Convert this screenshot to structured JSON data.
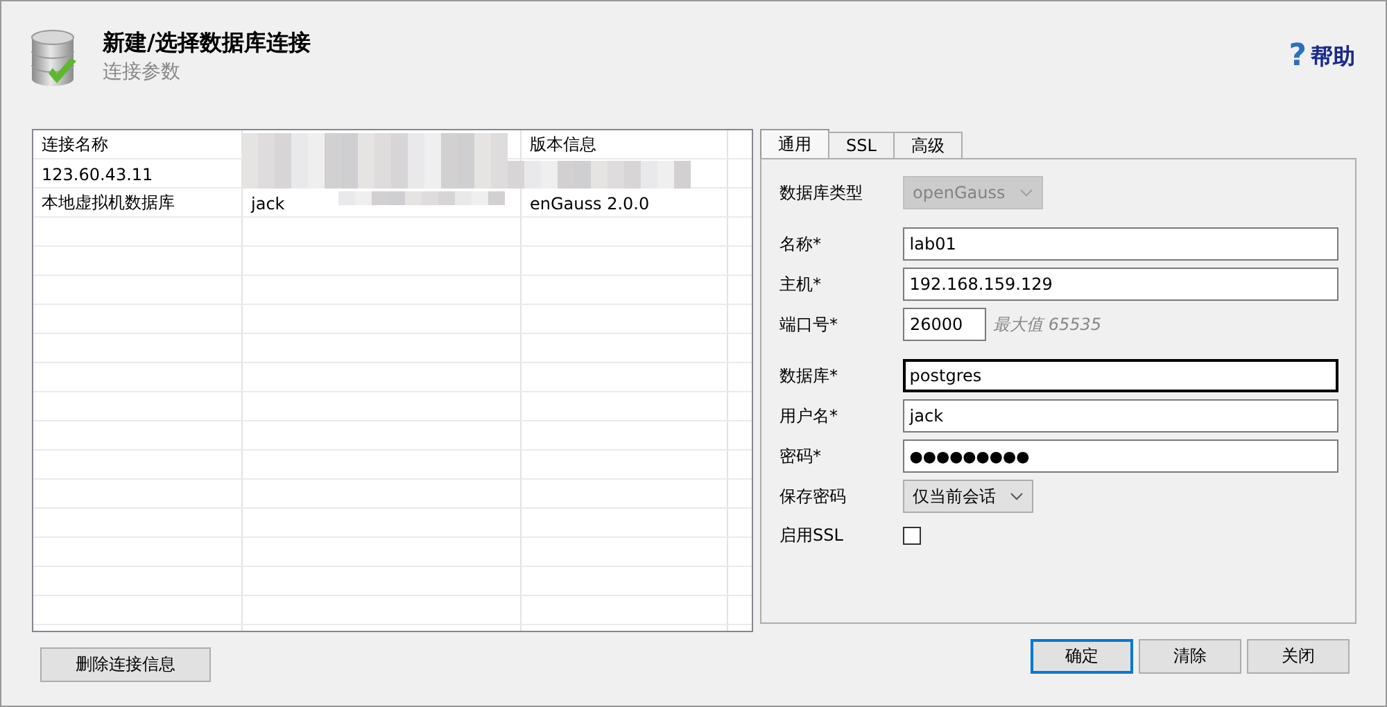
{
  "header": {
    "title": "新建/选择数据库连接",
    "subtitle": "连接参数",
    "help_icon": "?",
    "help_label": "帮助"
  },
  "table": {
    "columns": {
      "column_1": "连接名称",
      "column_3": "版本信息"
    },
    "rows": [
      {
        "column_1": "123.60.43.11"
      },
      {
        "column_1": "本地虚拟机数据库",
        "column_2": "jack",
        "column_3": "enGauss 2.0.0"
      }
    ]
  },
  "tabs": [
    {
      "label": "通用",
      "selected": true
    },
    {
      "label": "SSL",
      "selected": false
    },
    {
      "label": "高级",
      "selected": false
    }
  ],
  "form": [
    {
      "kind": "select",
      "label": "数据库类型",
      "value": "openGauss",
      "disabled": true
    },
    {
      "kind": "text",
      "label": "名称*",
      "value": "lab01",
      "focused": false
    },
    {
      "kind": "text",
      "label": "主机*",
      "value": "192.168.159.129",
      "focused": false
    },
    {
      "kind": "port",
      "label": "端口号*",
      "value": "26000",
      "hint": "最大值 65535",
      "focused": false
    },
    {
      "kind": "text",
      "label": "数据库*",
      "value": "postgres",
      "focused": true
    },
    {
      "kind": "text",
      "label": "用户名*",
      "value": "jack",
      "focused": false
    },
    {
      "kind": "password",
      "label": "密码*",
      "value": "●●●●●●●●●",
      "focused": false
    },
    {
      "kind": "select",
      "label": "保存密码",
      "value": "仅当前会话",
      "disabled": false
    },
    {
      "kind": "checkbox",
      "label": "启用SSL",
      "checked": false
    }
  ],
  "delete_button": "删除连接信息",
  "buttons": [
    {
      "label": "确定",
      "default": true
    },
    {
      "label": "清除",
      "default": false
    },
    {
      "label": "关闭",
      "default": false
    }
  ]
}
